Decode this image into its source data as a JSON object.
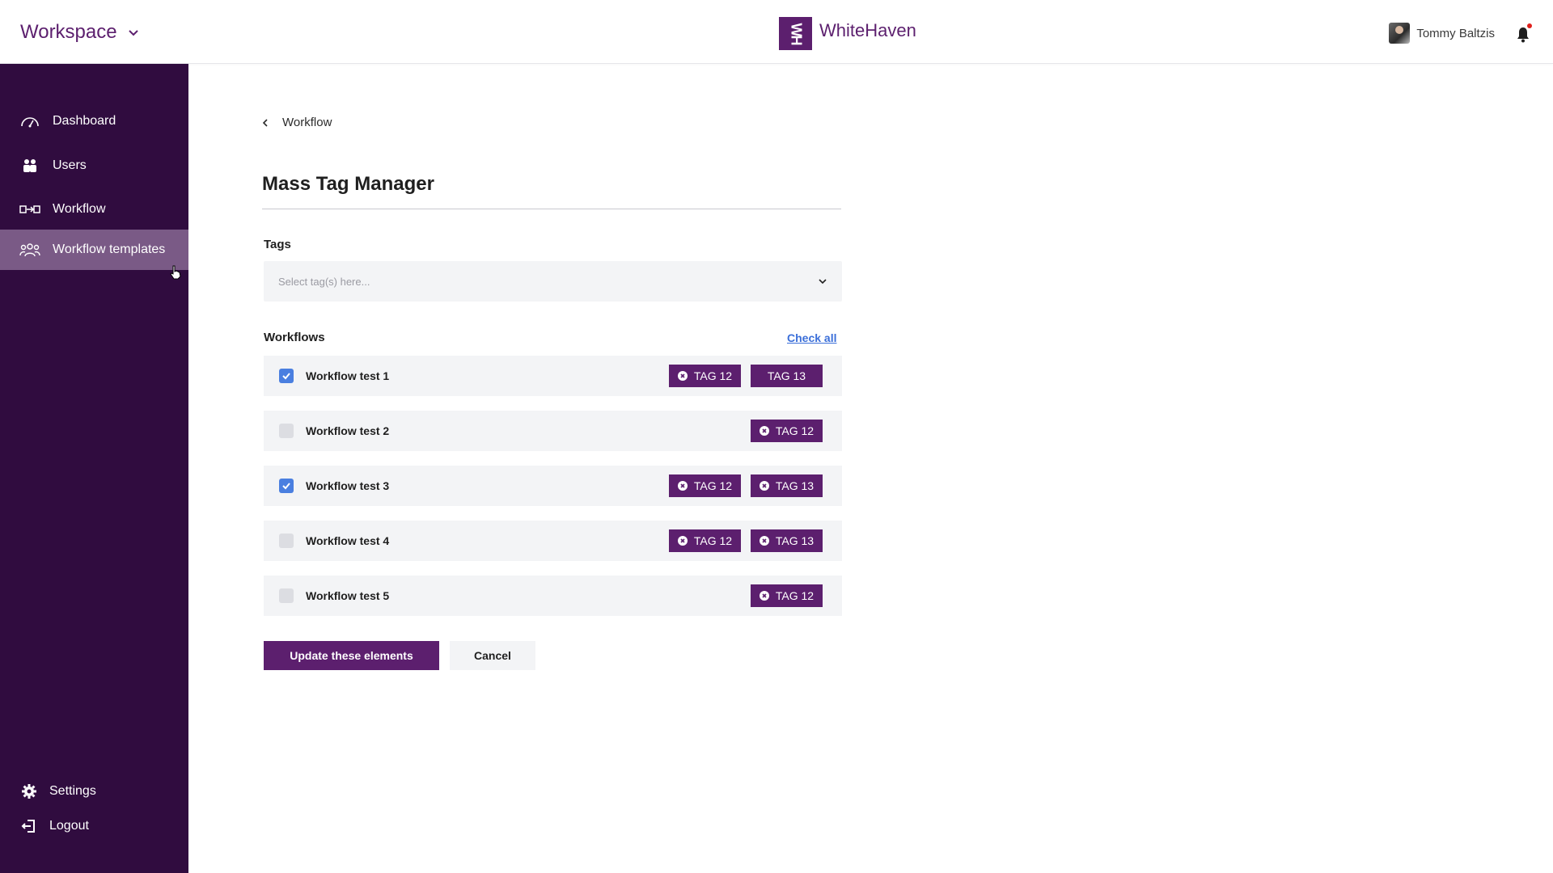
{
  "header": {
    "workspace_label": "Workspace",
    "brand_logo_text": "WH",
    "brand_name": "WhiteHaven",
    "user_name": "Tommy Baltzis"
  },
  "sidebar": {
    "items": [
      {
        "label": "Dashboard",
        "icon": "dashboard-gauge-icon"
      },
      {
        "label": "Users",
        "icon": "users-icon"
      },
      {
        "label": "Workflow",
        "icon": "workflow-icon"
      },
      {
        "label": "Workflow templates",
        "icon": "workflow-templates-icon",
        "active": true
      }
    ],
    "bottom": [
      {
        "label": "Settings",
        "icon": "gear-icon"
      },
      {
        "label": "Logout",
        "icon": "logout-icon"
      }
    ]
  },
  "main": {
    "breadcrumb": "Workflow",
    "title": "Mass Tag Manager",
    "tags_label": "Tags",
    "tags_placeholder": "Select tag(s) here...",
    "workflows_label": "Workflows",
    "check_all": "Check all",
    "workflows": [
      {
        "name": "Workflow test 1",
        "checked": true,
        "tags": [
          "TAG 12",
          "TAG 13"
        ]
      },
      {
        "name": "Workflow test 2",
        "checked": false,
        "tags": [
          "TAG 12"
        ]
      },
      {
        "name": "Workflow test 3",
        "checked": true,
        "tags": [
          "TAG 12",
          "TAG 13"
        ]
      },
      {
        "name": "Workflow test 4",
        "checked": false,
        "tags": [
          "TAG 12",
          "TAG 13"
        ]
      },
      {
        "name": "Workflow test 5",
        "checked": false,
        "tags": [
          "TAG 12"
        ]
      }
    ],
    "update_button": "Update these elements",
    "cancel_button": "Cancel"
  },
  "colors": {
    "brand": "#5c1f6e",
    "sidebar_bg": "#300c3f",
    "sidebar_active": "#7a5a86",
    "checkbox_on": "#4a7fe0",
    "link": "#3b6fd9",
    "notification_dot": "#e0201c"
  }
}
